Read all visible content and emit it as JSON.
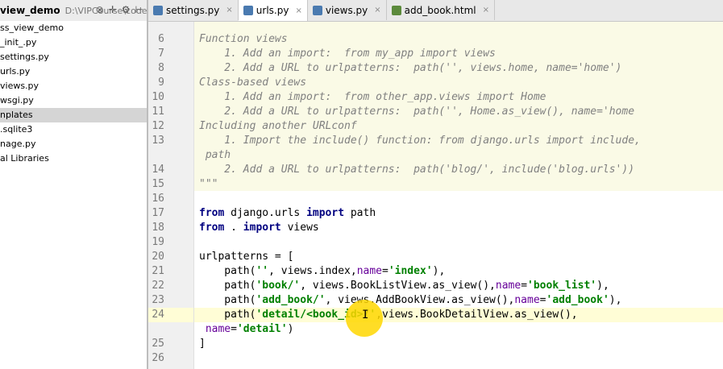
{
  "project": {
    "title": "view_demo",
    "path": "D:\\VIPCourse\\codes\\pyt"
  },
  "toolbar_icons": [
    "settings-icon",
    "collapse-icon",
    "gear-icon",
    "hide-icon"
  ],
  "tree": [
    {
      "label": "ss_view_demo"
    },
    {
      "label": "_init_.py"
    },
    {
      "label": "settings.py"
    },
    {
      "label": "urls.py"
    },
    {
      "label": "views.py"
    },
    {
      "label": "wsgi.py"
    },
    {
      "label": "nplates",
      "selected": true
    },
    {
      "label": ".sqlite3"
    },
    {
      "label": "nage.py"
    },
    {
      "label": "al Libraries"
    }
  ],
  "tabs": [
    {
      "label": "settings.py",
      "icon_color": "#4a7ab0"
    },
    {
      "label": "urls.py",
      "icon_color": "#4a7ab0",
      "active": true
    },
    {
      "label": "views.py",
      "icon_color": "#4a7ab0"
    },
    {
      "label": "add_book.html",
      "icon_color": "#5c8a3c"
    }
  ],
  "lines": [
    {
      "n": "6",
      "parts": [
        {
          "t": "doc",
          "v": "Function views"
        }
      ]
    },
    {
      "n": "7",
      "parts": [
        {
          "t": "doc",
          "v": "    1. Add an import:  from my_app import views"
        }
      ]
    },
    {
      "n": "8",
      "parts": [
        {
          "t": "doc",
          "v": "    2. Add a URL to urlpatterns:  path('', views.home, name='home')"
        }
      ]
    },
    {
      "n": "9",
      "parts": [
        {
          "t": "doc",
          "v": "Class-based views"
        }
      ]
    },
    {
      "n": "10",
      "parts": [
        {
          "t": "doc",
          "v": "    1. Add an import:  from other_app.views import Home"
        }
      ]
    },
    {
      "n": "11",
      "parts": [
        {
          "t": "doc",
          "v": "    2. Add a URL to urlpatterns:  path('', Home.as_view(), name='home"
        }
      ]
    },
    {
      "n": "12",
      "parts": [
        {
          "t": "doc",
          "v": "Including another URLconf"
        }
      ]
    },
    {
      "n": "13",
      "parts": [
        {
          "t": "doc",
          "v": "    1. Import the include() function: from django.urls import include,"
        }
      ]
    },
    {
      "n": "",
      "parts": [
        {
          "t": "doc",
          "v": " path"
        }
      ]
    },
    {
      "n": "14",
      "parts": [
        {
          "t": "doc",
          "v": "    2. Add a URL to urlpatterns:  path('blog/', include('blog.urls'))"
        }
      ]
    },
    {
      "n": "15",
      "parts": [
        {
          "t": "doc",
          "v": "\"\"\""
        }
      ]
    },
    {
      "n": "16",
      "parts": []
    },
    {
      "n": "17",
      "parts": [
        {
          "t": "kw",
          "v": "from"
        },
        {
          "t": "plain",
          "v": " django.urls "
        },
        {
          "t": "kw",
          "v": "import"
        },
        {
          "t": "plain",
          "v": " path"
        }
      ]
    },
    {
      "n": "18",
      "parts": [
        {
          "t": "kw",
          "v": "from"
        },
        {
          "t": "plain",
          "v": " . "
        },
        {
          "t": "kw",
          "v": "import"
        },
        {
          "t": "plain",
          "v": " views"
        }
      ]
    },
    {
      "n": "19",
      "parts": []
    },
    {
      "n": "20",
      "parts": [
        {
          "t": "plain",
          "v": "urlpatterns = ["
        }
      ]
    },
    {
      "n": "21",
      "parts": [
        {
          "t": "plain",
          "v": "    path("
        },
        {
          "t": "str",
          "v": "''"
        },
        {
          "t": "plain",
          "v": ", views.index,"
        },
        {
          "t": "kwarg",
          "v": "name"
        },
        {
          "t": "plain",
          "v": "="
        },
        {
          "t": "str",
          "v": "'index'"
        },
        {
          "t": "plain",
          "v": "),"
        }
      ]
    },
    {
      "n": "22",
      "parts": [
        {
          "t": "plain",
          "v": "    path("
        },
        {
          "t": "str",
          "v": "'book/'"
        },
        {
          "t": "plain",
          "v": ", views.BookListView.as_view(),"
        },
        {
          "t": "kwarg",
          "v": "name"
        },
        {
          "t": "plain",
          "v": "="
        },
        {
          "t": "str",
          "v": "'book_list'"
        },
        {
          "t": "plain",
          "v": "),"
        }
      ]
    },
    {
      "n": "23",
      "parts": [
        {
          "t": "plain",
          "v": "    path("
        },
        {
          "t": "str",
          "v": "'add_book/'"
        },
        {
          "t": "plain",
          "v": ", views.AddBookView.as_view(),"
        },
        {
          "t": "kwarg",
          "v": "name"
        },
        {
          "t": "plain",
          "v": "="
        },
        {
          "t": "str",
          "v": "'add_book'"
        },
        {
          "t": "plain",
          "v": "),"
        }
      ]
    },
    {
      "n": "24",
      "current": true,
      "parts": [
        {
          "t": "plain",
          "v": "    path("
        },
        {
          "t": "str",
          "v": "'detail/<book_id>/'"
        },
        {
          "t": "plain",
          "v": ",views.BookDetailView.as_view(),"
        }
      ]
    },
    {
      "n": "",
      "parts": [
        {
          "t": "plain",
          "v": " "
        },
        {
          "t": "kwarg",
          "v": "name"
        },
        {
          "t": "plain",
          "v": "="
        },
        {
          "t": "str",
          "v": "'detail'"
        },
        {
          "t": "plain",
          "v": ")"
        }
      ]
    },
    {
      "n": "25",
      "parts": [
        {
          "t": "plain",
          "v": "]"
        }
      ]
    },
    {
      "n": "26",
      "parts": []
    }
  ]
}
